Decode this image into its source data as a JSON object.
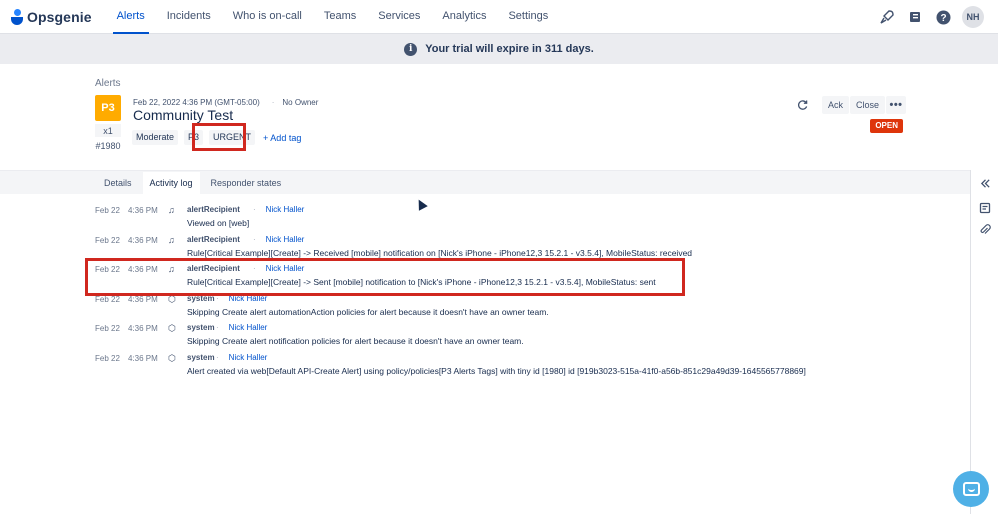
{
  "app": {
    "name": "Opsgenie"
  },
  "nav": {
    "items": [
      {
        "label": "Alerts",
        "active": true
      },
      {
        "label": "Incidents"
      },
      {
        "label": "Who is on-call"
      },
      {
        "label": "Teams"
      },
      {
        "label": "Services"
      },
      {
        "label": "Analytics"
      },
      {
        "label": "Settings"
      }
    ],
    "icons": [
      "rocket-icon",
      "book-icon",
      "help-icon"
    ],
    "avatar": "NH"
  },
  "banner": {
    "text": "Your trial will expire in 311 days."
  },
  "alert": {
    "breadcrumb": "Alerts",
    "priority": "P3",
    "count": "x1",
    "tiny_id": "#1980",
    "created": "Feb 22, 2022 4:36 PM (GMT-05:00)",
    "owner": "No Owner",
    "title": "Community Test",
    "tags": [
      "Moderate",
      "P3",
      "URGENT"
    ],
    "add_tag_label": "+ Add tag",
    "status": "OPEN",
    "actions": {
      "ack": "Ack",
      "close": "Close"
    }
  },
  "tabs": [
    {
      "label": "Details"
    },
    {
      "label": "Activity log",
      "active": true
    },
    {
      "label": "Responder states"
    }
  ],
  "activity": [
    {
      "date": "Feb 22",
      "time": "4:36 PM",
      "icon": "recipient-icon",
      "actor": "alertRecipient",
      "user": "Nick Haller",
      "message": "Viewed on [web]"
    },
    {
      "date": "Feb 22",
      "time": "4:36 PM",
      "icon": "recipient-icon",
      "actor": "alertRecipient",
      "user": "Nick Haller",
      "message": "Rule[Critical Example][Create] -> Received [mobile] notification on [Nick's iPhone - iPhone12,3 15.2.1 - v3.5.4], MobileStatus: received"
    },
    {
      "date": "Feb 22",
      "time": "4:36 PM",
      "icon": "recipient-icon",
      "actor": "alertRecipient",
      "user": "Nick Haller",
      "message": "Rule[Critical Example][Create] -> Sent [mobile] notification to [Nick's iPhone - iPhone12,3 15.2.1 - v3.5.4], MobileStatus: sent"
    },
    {
      "date": "Feb 22",
      "time": "4:36 PM",
      "icon": "system-icon",
      "actor": "system",
      "user": "Nick Haller",
      "message": "Skipping Create alert automationAction policies for alert because it doesn't have an owner team."
    },
    {
      "date": "Feb 22",
      "time": "4:36 PM",
      "icon": "system-icon",
      "actor": "system",
      "user": "Nick Haller",
      "message": "Skipping Create alert notification policies for alert because it doesn't have an owner team."
    },
    {
      "date": "Feb 22",
      "time": "4:36 PM",
      "icon": "system-icon",
      "actor": "system",
      "user": "Nick Haller",
      "message": "Alert created via web[Default API-Create Alert] using policy/policies[P3 Alerts Tags] with tiny id [1980] id [919b3023-515a-41f0-a56b-851c29a49d39-1645565778869]"
    }
  ],
  "colors": {
    "accent": "#0052cc",
    "priority_p3": "#ffab00",
    "status_open": "#de350b",
    "highlight": "#d0281f"
  }
}
